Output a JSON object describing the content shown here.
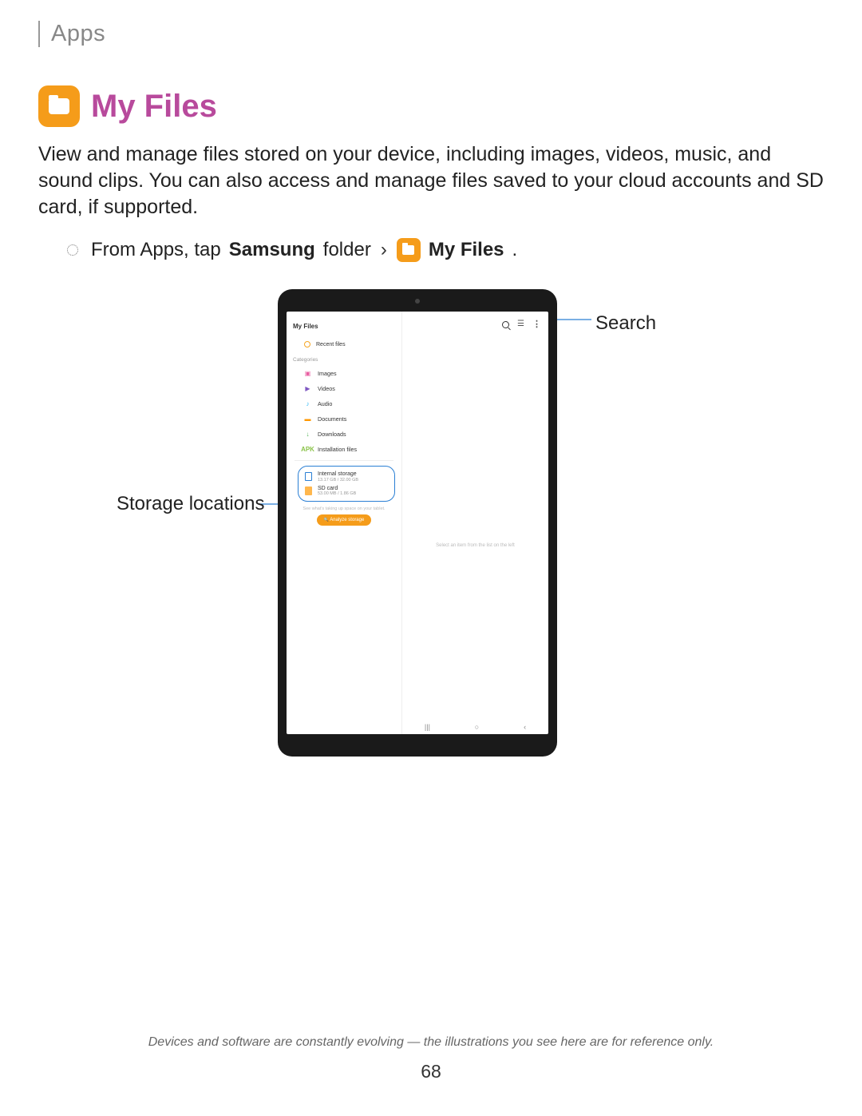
{
  "section": "Apps",
  "title": "My Files",
  "intro": "View and manage files stored on your device, including images, videos, music, and sound clips. You can also access and manage files saved to your cloud accounts and SD card, if supported.",
  "step": {
    "prefix": "From Apps, tap ",
    "samsung": "Samsung",
    "folder": " folder ",
    "arrow": "›",
    "app": "My Files",
    "suffix": "."
  },
  "callouts": {
    "search": "Search",
    "storage": "Storage locations"
  },
  "tablet": {
    "app_title": "My Files",
    "recent": "Recent files",
    "cat_label": "Categories",
    "cats": {
      "images": "Images",
      "videos": "Videos",
      "audio": "Audio",
      "documents": "Documents",
      "downloads": "Downloads",
      "installation": "Installation files"
    },
    "storage": {
      "internal_label": "Internal storage",
      "internal_sub": "13.17 GB / 32.00 GB",
      "sd_label": "SD card",
      "sd_sub": "53.00 MB / 1.86 GB"
    },
    "analyze_note": "See what's taking up space on your tablet.",
    "analyze_btn": "Analyze storage",
    "main_hint": "Select an item from the list on the left",
    "nav": {
      "recent": "|||",
      "home": "○",
      "back": "‹"
    }
  },
  "footer_note": "Devices and software are constantly evolving — the illustrations you see here are for reference only.",
  "page_number": "68"
}
